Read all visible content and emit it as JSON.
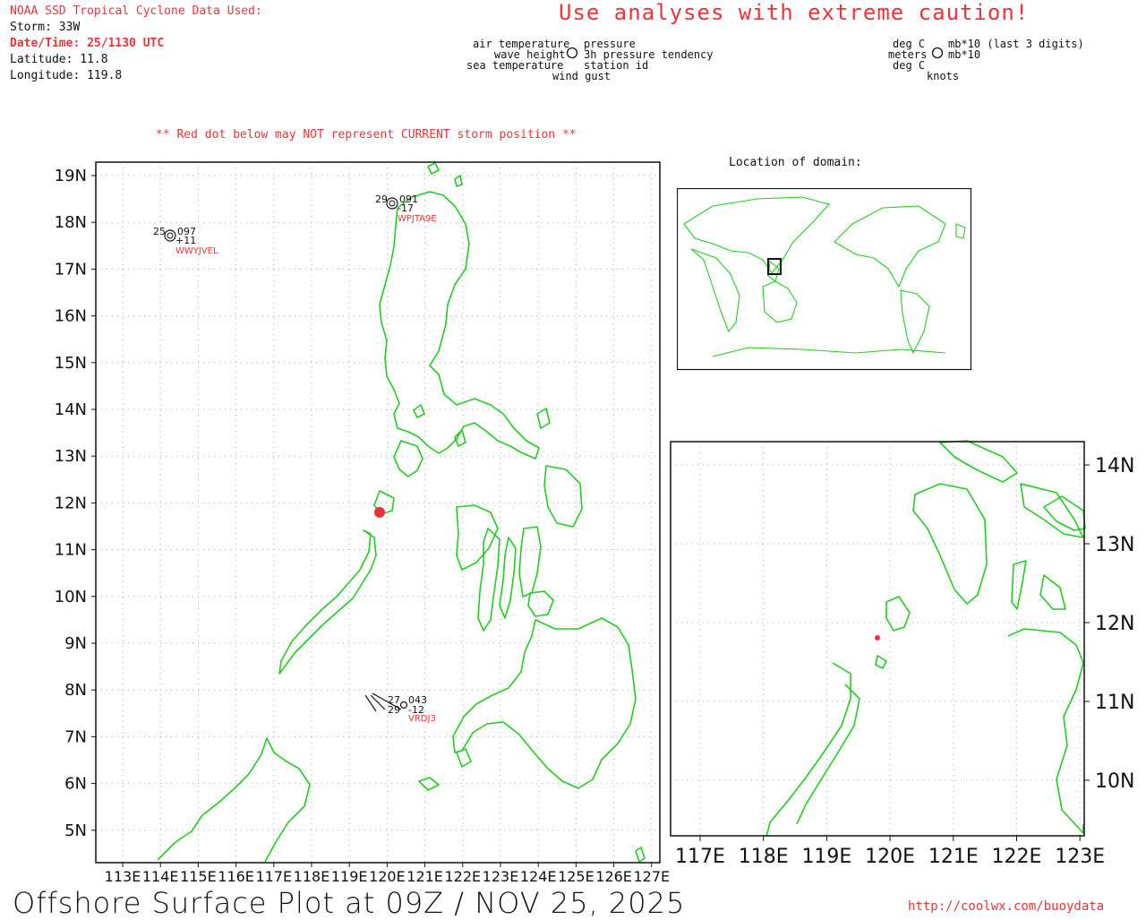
{
  "header": {
    "source": "NOAA SSD Tropical Cyclone Data Used:",
    "storm": "Storm: 33W",
    "datetime": "Date/Time: 25/1130 UTC",
    "latitude": "Latitude: 11.8",
    "longitude": "Longitude: 119.8",
    "caution": "Use analyses with extreme caution!",
    "red_dot_warning": "** Red dot below may NOT represent CURRENT storm position **"
  },
  "legend": {
    "air_temperature": "air temperature",
    "wave_height": "wave height",
    "sea_temperature": "sea temperature",
    "pressure": "pressure",
    "pressure_tendency": "3h pressure tendency",
    "station_id": "station id",
    "wind_gust": "wind gust",
    "unit_deg_c": "deg C",
    "unit_meters": "meters",
    "unit_deg_c_2": "deg C",
    "unit_mb10_last3": "mb*10 (last 3 digits)",
    "unit_mb10": "mb*10",
    "unit_knots": "knots"
  },
  "main_map": {
    "lat_labels": [
      "19N",
      "18N",
      "17N",
      "16N",
      "15N",
      "14N",
      "13N",
      "12N",
      "11N",
      "10N",
      "9N",
      "8N",
      "7N",
      "6N",
      "5N"
    ],
    "lon_labels": [
      "113E",
      "114E",
      "115E",
      "116E",
      "117E",
      "118E",
      "119E",
      "120E",
      "121E",
      "122E",
      "123E",
      "124E",
      "125E",
      "126E",
      "127E"
    ],
    "storm_position": {
      "lat": 11.8,
      "lon": 119.8
    },
    "stations": [
      {
        "id": "WPJTA9E",
        "lat": 18.4,
        "lon": 120.2,
        "air_temp": "29",
        "pressure": "091",
        "tendency": "-17"
      },
      {
        "id": "WWYJVEL",
        "lat": 17.7,
        "lon": 114.3,
        "air_temp": "25",
        "pressure": "097",
        "tendency": "+11"
      },
      {
        "id": "VRDJ3",
        "lat": 7.7,
        "lon": 120.5,
        "air_temp": "27",
        "sea_temp": "29",
        "pressure": "043",
        "tendency": "-12"
      }
    ]
  },
  "inset": {
    "title": "Location of domain:"
  },
  "zoom_map": {
    "lat_labels": [
      "14N",
      "13N",
      "12N",
      "11N",
      "10N"
    ],
    "lon_labels": [
      "117E",
      "118E",
      "119E",
      "120E",
      "121E",
      "122E",
      "123E"
    ]
  },
  "footer": {
    "title": "Offshore Surface Plot at 09Z / NOV 25, 2025",
    "url": "http://coolwx.com/buoydata"
  },
  "colors": {
    "coast": "#22cc22",
    "accent": "#e8343a",
    "grid": "#999999"
  }
}
